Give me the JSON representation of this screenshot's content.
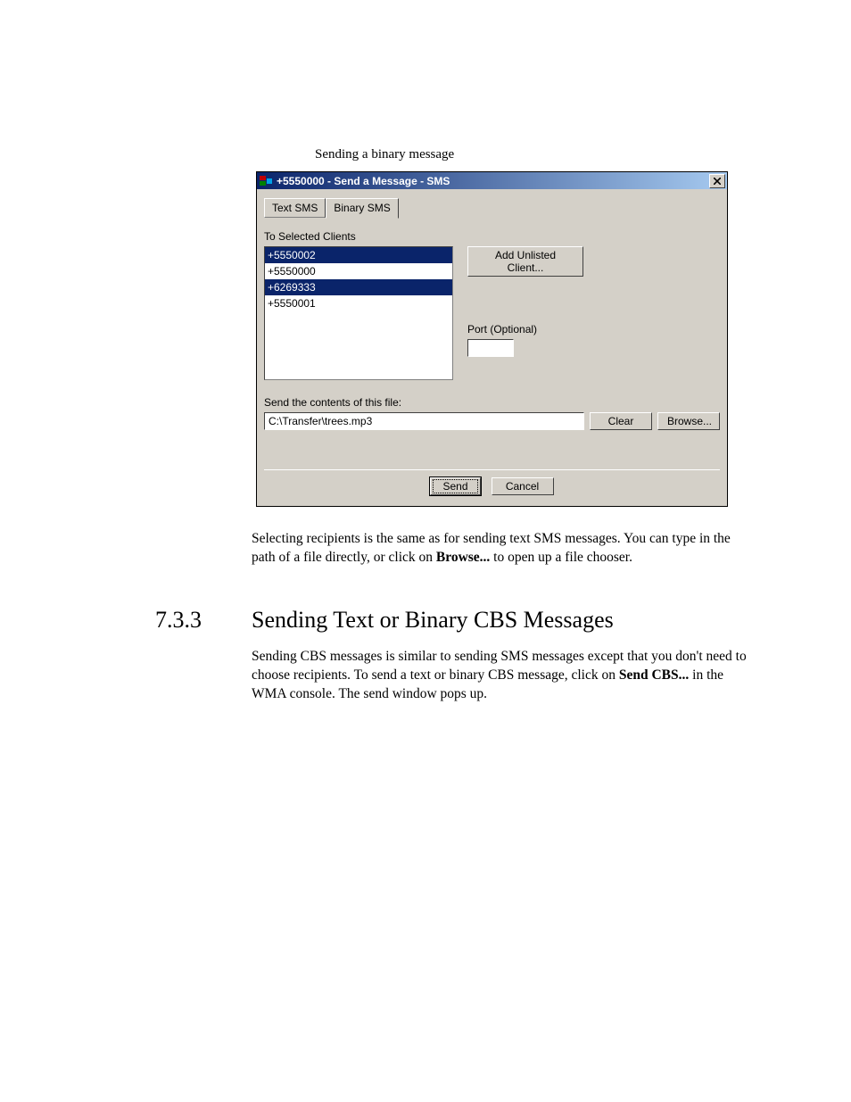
{
  "caption": "Sending a binary message",
  "dialog": {
    "title": " +5550000 - Send a Message - SMS",
    "tabs": {
      "text": "Text SMS",
      "binary": "Binary SMS"
    },
    "to_label": "To Selected Clients",
    "clients": [
      {
        "number": "+5550002",
        "selected": true
      },
      {
        "number": "+5550000",
        "selected": false
      },
      {
        "number": "+6269333",
        "selected": true
      },
      {
        "number": "+5550001",
        "selected": false
      }
    ],
    "add_unlisted": "Add Unlisted Client...",
    "port_label": "Port (Optional)",
    "port_value": "",
    "file_label": "Send the contents of this file:",
    "file_value": "C:\\Transfer\\trees.mp3",
    "clear": "Clear",
    "browse": "Browse...",
    "send": "Send",
    "cancel": "Cancel"
  },
  "para1_a": "Selecting recipients is the same as for sending text SMS messages. You can type in the path of a file directly, or click on ",
  "para1_bold": "Browse...",
  "para1_b": " to open up a file chooser.",
  "heading_num": "7.3.3",
  "heading_text": "Sending Text or Binary CBS Messages",
  "para2_a": "Sending CBS messages is similar to sending SMS messages except that you don't need to choose recipients. To send a text or binary CBS message, click on ",
  "para2_bold": "Send CBS...",
  "para2_b": " in the WMA console. The send window pops up."
}
